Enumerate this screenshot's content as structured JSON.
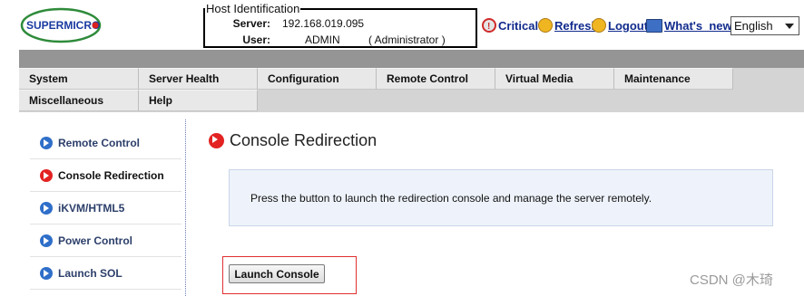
{
  "brand": {
    "logo_text": "SUPERMICRO",
    "logo_color": "#1a3aa0",
    "ring_color": "#2e8b3a"
  },
  "host": {
    "legend": "Host Identification",
    "server_label": "Server:",
    "server_value": "192.168.019.095",
    "user_label": "User:",
    "user_value": "ADMIN",
    "user_role": "( Administrator )"
  },
  "top_links": {
    "critical": "Critical",
    "refresh": "Refresh",
    "logout": "Logout",
    "whats_new": "What's_new"
  },
  "language": {
    "selected": "English"
  },
  "menu": {
    "row1": [
      "System",
      "Server Health",
      "Configuration",
      "Remote Control",
      "Virtual Media",
      "Maintenance"
    ],
    "row2": [
      "Miscellaneous",
      "Help"
    ]
  },
  "sidebar": {
    "items": [
      {
        "label": "Remote Control",
        "active": false
      },
      {
        "label": "Console Redirection",
        "active": true
      },
      {
        "label": "iKVM/HTML5",
        "active": false
      },
      {
        "label": "Power Control",
        "active": false
      },
      {
        "label": "Launch SOL",
        "active": false
      }
    ]
  },
  "main": {
    "title": "Console Redirection",
    "info_text": "Press the button to launch the redirection console and manage the server remotely.",
    "launch_button": "Launch Console"
  },
  "watermark": "CSDN @木琦",
  "colors": {
    "active_bullet": "#e32222",
    "inactive_bullet": "#2f6fc9",
    "link": "#102a8c",
    "highlight_frame": "#e03030"
  }
}
